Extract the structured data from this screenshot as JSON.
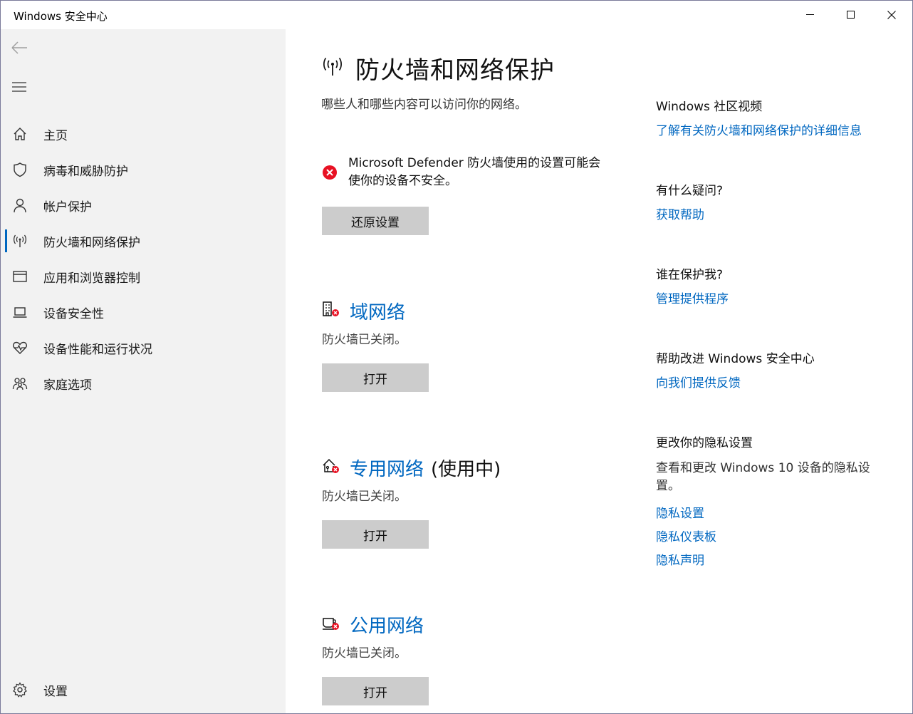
{
  "window": {
    "title": "Windows 安全中心"
  },
  "sidebar": {
    "items": [
      {
        "label": "主页",
        "icon": "home-icon"
      },
      {
        "label": "病毒和威胁防护",
        "icon": "shield-icon"
      },
      {
        "label": "帐户保护",
        "icon": "person-icon"
      },
      {
        "label": "防火墙和网络保护",
        "icon": "antenna-icon",
        "active": true
      },
      {
        "label": "应用和浏览器控制",
        "icon": "browser-window-icon"
      },
      {
        "label": "设备安全性",
        "icon": "laptop-icon"
      },
      {
        "label": "设备性能和运行状况",
        "icon": "heart-pulse-icon"
      },
      {
        "label": "家庭选项",
        "icon": "family-icon"
      }
    ],
    "settings_label": "设置"
  },
  "main": {
    "title": "防火墙和网络保护",
    "subtitle": "哪些人和哪些内容可以访问你的网络。",
    "warning": {
      "line1": "Microsoft Defender 防火墙使用的设置可能会",
      "line2": "使你的设备不安全。"
    },
    "restore_button": "还原设置",
    "networks": [
      {
        "name": "域网络",
        "suffix": "",
        "status": "防火墙已关闭。",
        "button": "打开",
        "icon": "domain-network-icon"
      },
      {
        "name": "专用网络",
        "suffix": "(使用中)",
        "status": "防火墙已关闭。",
        "button": "打开",
        "icon": "private-network-icon"
      },
      {
        "name": "公用网络",
        "suffix": "",
        "status": "防火墙已关闭。",
        "button": "打开",
        "icon": "public-network-icon"
      }
    ]
  },
  "right": {
    "community_heading": "Windows 社区视频",
    "community_link": "了解有关防火墙和网络保护的详细信息",
    "question_heading": "有什么疑问?",
    "help_link": "获取帮助",
    "who_heading": "谁在保护我?",
    "providers_link": "管理提供程序",
    "improve_heading": "帮助改进 Windows 安全中心",
    "feedback_link": "向我们提供反馈",
    "privacy_heading": "更改你的隐私设置",
    "privacy_text": "查看和更改 Windows 10 设备的隐私设置。",
    "privacy_links": [
      "隐私设置",
      "隐私仪表板",
      "隐私声明"
    ]
  },
  "colors": {
    "accent": "#0067c0",
    "error": "#e81123",
    "sidebar_bg": "#f2f2f2",
    "button_bg": "#cccccc"
  }
}
